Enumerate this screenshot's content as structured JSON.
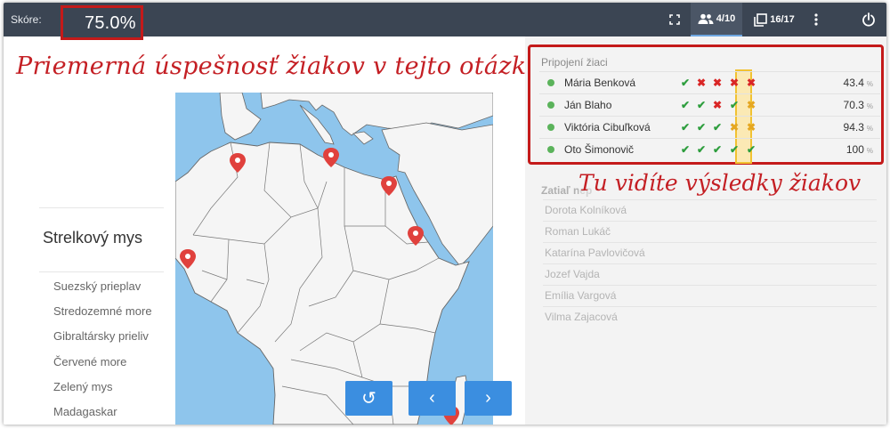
{
  "topbar": {
    "score_label": "Skóre:",
    "score_value": "75.0%",
    "students_count": "4/10",
    "questions_count": "16/17",
    "icons": [
      "fullscreen-icon",
      "users-icon",
      "questions-icon",
      "more-vert-icon",
      "power-icon"
    ]
  },
  "left": {
    "headline": "Priemerná úspešnosť žiakov v tejto otázke",
    "question": "Strelkový mys",
    "options": [
      "Suezský prieplav",
      "Stredozemné more",
      "Gibraltársky prieliv",
      "Červené more",
      "Zelený mys",
      "Madagaskar"
    ],
    "controls": {
      "reset_icon": "↺",
      "prev_icon": "‹",
      "next_icon": "›"
    }
  },
  "right": {
    "connected_title": "Pripojení žiaci",
    "students": [
      {
        "name": "Mária Benková",
        "marks": [
          "ok",
          "bad",
          "bad",
          "bad",
          "bad"
        ],
        "pct": "43.4"
      },
      {
        "name": "Ján Blaho",
        "marks": [
          "ok",
          "ok",
          "bad",
          "ok",
          "warn"
        ],
        "pct": "70.3"
      },
      {
        "name": "Viktória Cibuľková",
        "marks": [
          "ok",
          "ok",
          "ok",
          "warn",
          "warn"
        ],
        "pct": "94.3"
      },
      {
        "name": "Oto Šimonovič",
        "marks": [
          "ok",
          "ok",
          "ok",
          "ok",
          "ok"
        ],
        "pct": "100"
      }
    ],
    "pct_unit": "%",
    "notyet_title": "Zatiaľ nep",
    "notyet": [
      "Dorota Kolníková",
      "Roman Lukáč",
      "Katarína Pavlovičová",
      "Jozef Vajda",
      "Emília Vargová",
      "Vilma Zajacová"
    ],
    "annotation": "Tu vidíte výsledky žiakov"
  },
  "colors": {
    "accent": "#3b8ee0",
    "topbar": "#3b4553",
    "annotation": "#c41f24",
    "ok": "#2e9e3e",
    "bad": "#d92626",
    "warn": "#e5a722"
  }
}
